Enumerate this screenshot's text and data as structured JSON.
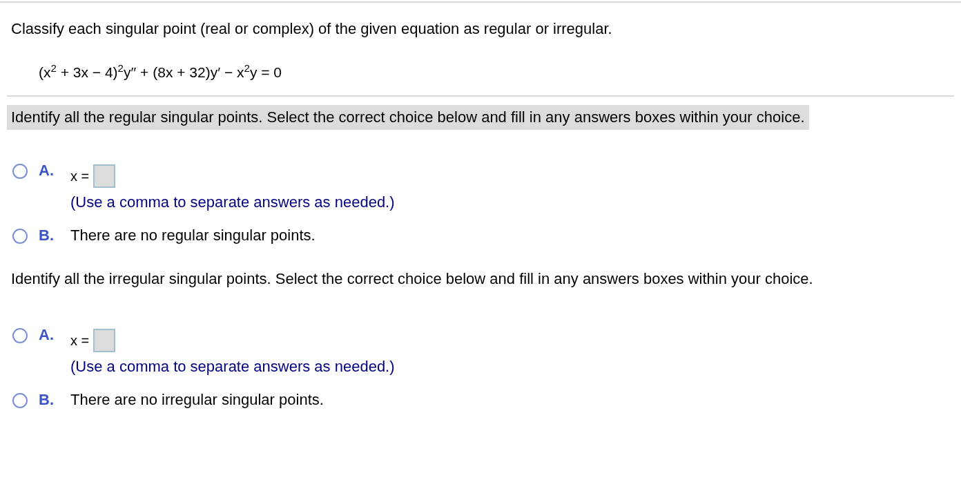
{
  "instruction": "Classify each singular point (real or complex) of the given equation as regular or irregular.",
  "equation": "(x$^{2}$ + 3x − 4)$^{2}$y′′ + (8x + 32)y′ − x$^{2}$y = 0",
  "parts": [
    {
      "prompt": "Identify all the regular singular points. Select the correct choice below and fill in any answers boxes within your choice.",
      "highlighted": true,
      "choices": [
        {
          "letter": "A.",
          "kind": "input",
          "selected": false,
          "prefix": "x =",
          "hint": "(Use a comma to separate answers as needed.)"
        },
        {
          "letter": "B.",
          "kind": "text",
          "selected": false,
          "text": "There are no regular singular points."
        }
      ]
    },
    {
      "prompt": "Identify all the irregular singular points. Select the correct choice below and fill in any answers boxes within your choice.",
      "highlighted": false,
      "choices": [
        {
          "letter": "A.",
          "kind": "input",
          "selected": false,
          "prefix": "x =",
          "hint": "(Use a comma to separate answers as needed.)"
        },
        {
          "letter": "B.",
          "kind": "text",
          "selected": false,
          "text": "There are no irregular singular points."
        }
      ]
    }
  ]
}
